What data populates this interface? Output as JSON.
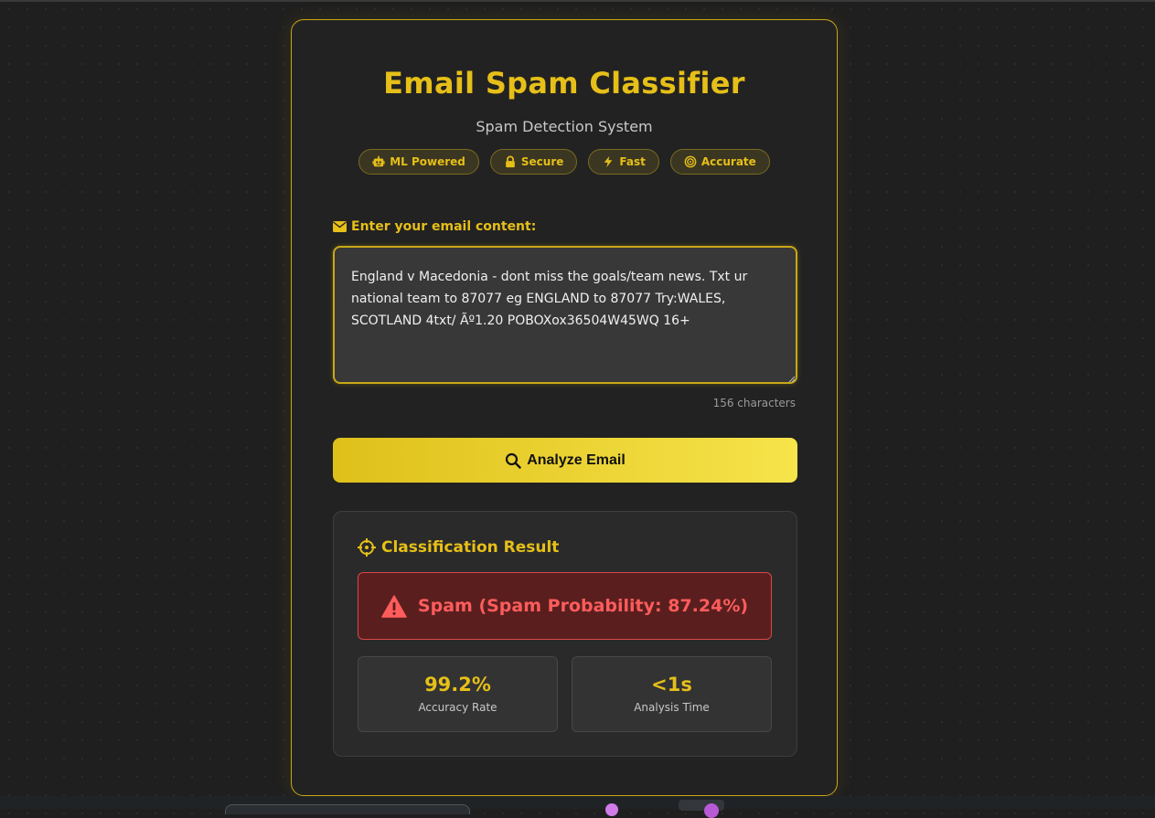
{
  "app": {
    "title": "Email Spam Classifier",
    "subtitle": "Spam Detection System"
  },
  "badges": [
    {
      "icon": "robot-icon",
      "label": "ML Powered"
    },
    {
      "icon": "lock-icon",
      "label": "Secure"
    },
    {
      "icon": "bolt-icon",
      "label": "Fast"
    },
    {
      "icon": "target-icon",
      "label": "Accurate"
    }
  ],
  "input": {
    "label": "Enter your email content:",
    "value": "England v Macedonia - dont miss the goals/team news. Txt ur national team to 87077 eg ENGLAND to 87077 Try:WALES, SCOTLAND 4txt/ Ãº1.20 POBOXox36504W45WQ 16+",
    "char_count": "156 characters"
  },
  "analyze_button": {
    "label": "Analyze Email"
  },
  "result": {
    "title": "Classification Result",
    "verdict": "Spam (Spam Probability: 87.24%)",
    "stats": [
      {
        "value": "99.2%",
        "label": "Accuracy Rate"
      },
      {
        "value": "<1s",
        "label": "Analysis Time"
      }
    ]
  },
  "colors": {
    "accent": "#e6bf18",
    "spam": "#ff5c5c",
    "background": "#1f1f1f",
    "card": "#222222"
  }
}
